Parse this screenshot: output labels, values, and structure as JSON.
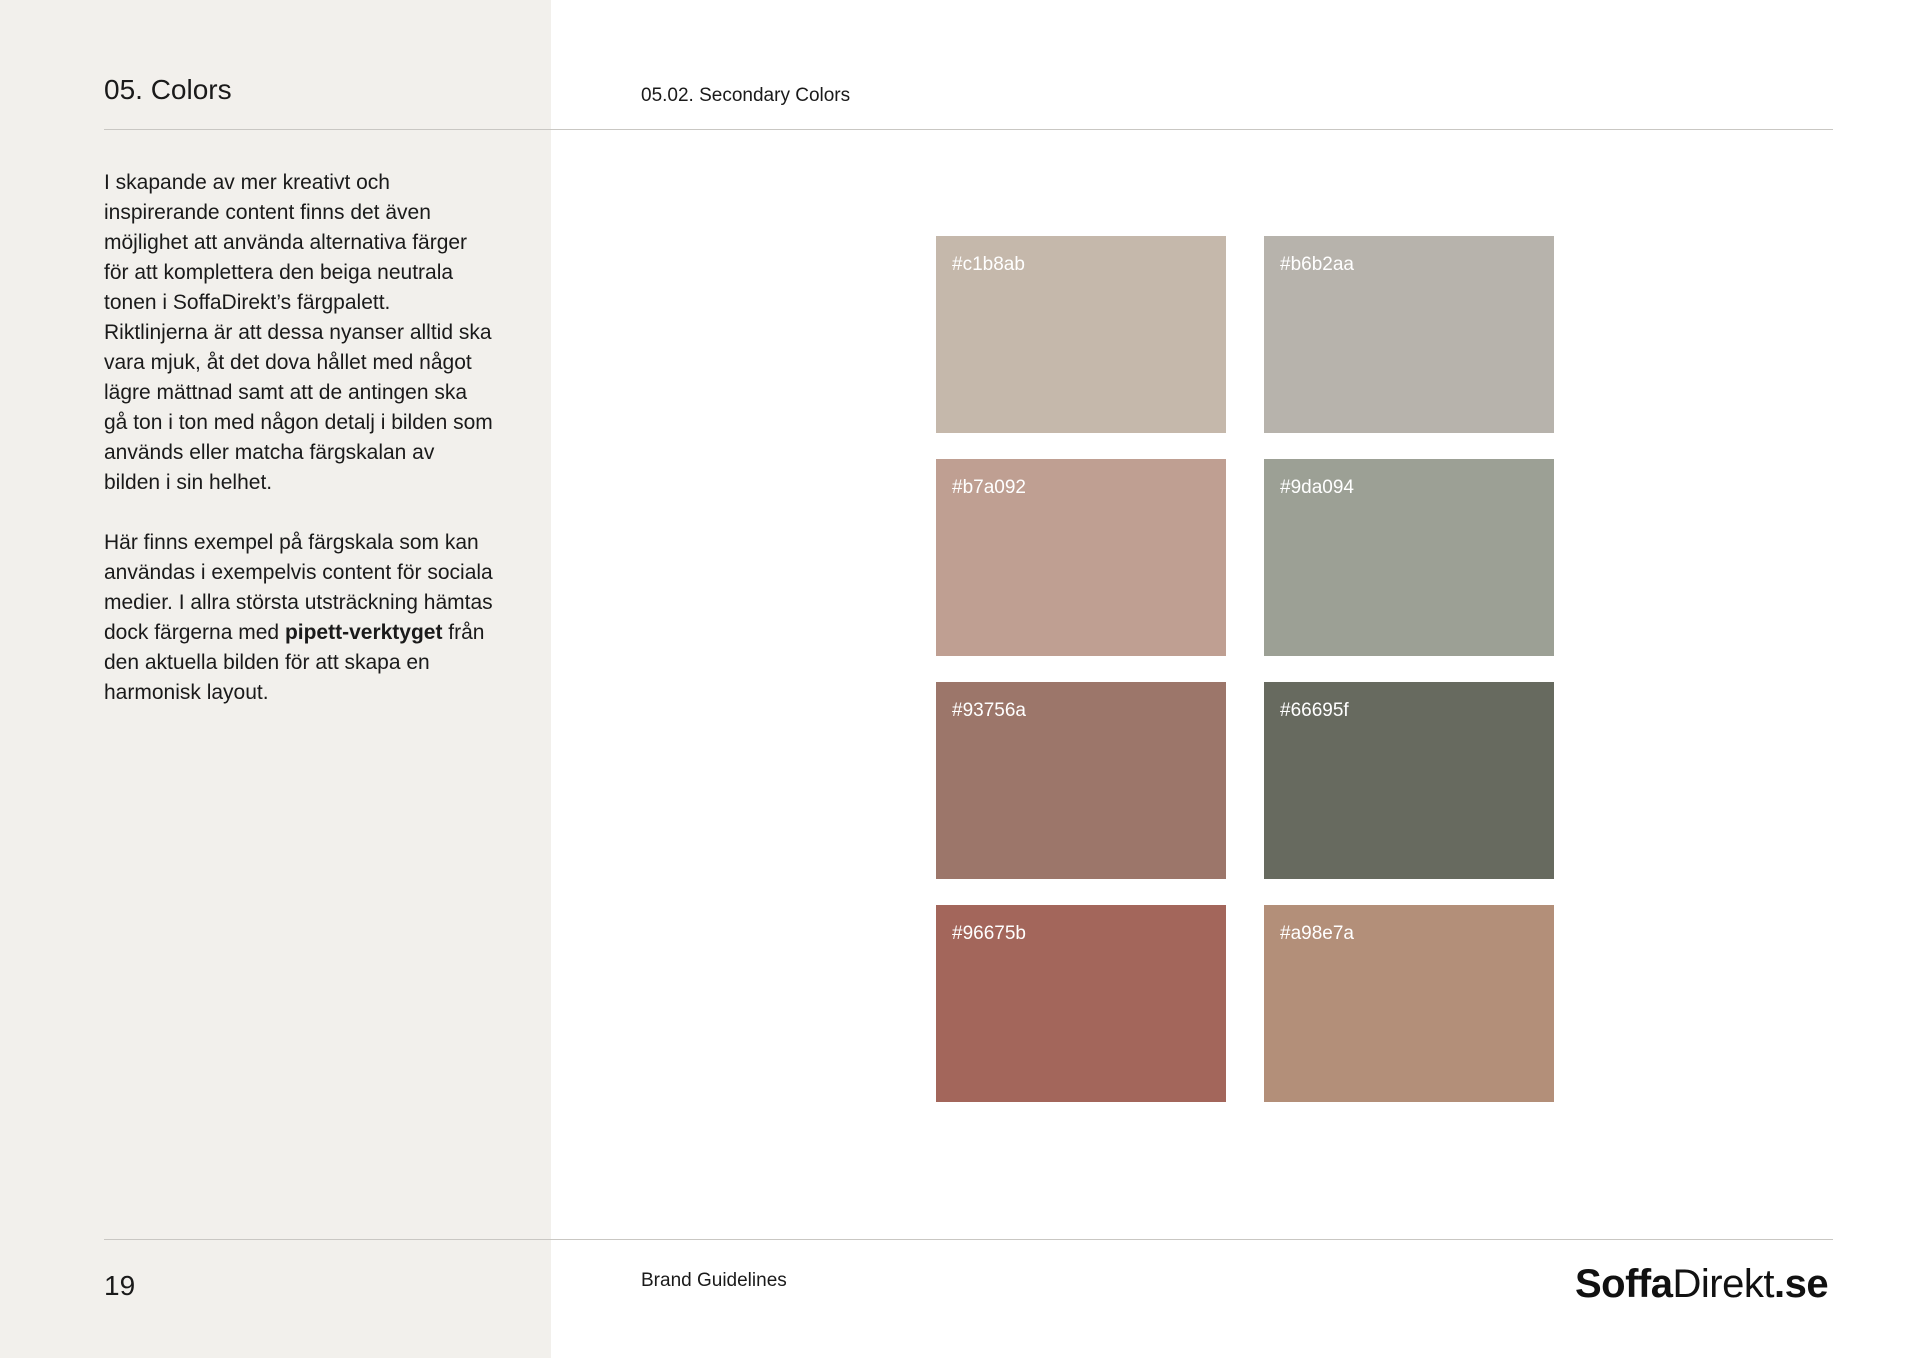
{
  "header": {
    "section_title": "05. Colors",
    "subsection_title": "05.02. Secondary Colors"
  },
  "body": {
    "paragraph1": "I skapande av mer kreativt och inspirerande content finns det även möjlighet att använda alternativa färger för att komplettera den beiga neutrala tonen i SoffaDirekt’s färgpalett. Riktlinjerna är att dessa nyanser alltid ska vara mjuk, åt det dova hållet med något lägre mättnad samt att de antingen ska gå ton i ton med någon detalj i bilden som används eller matcha färgskalan av bilden i sin helhet.",
    "paragraph2_before": "Här finns exempel på färgskala som kan användas i exempelvis content för sociala medier. I allra största utsträckning hämtas dock färgerna med ",
    "paragraph2_bold": "pipett-verktyget",
    "paragraph2_after": " från den aktuella bilden för att skapa en harmonisk layout."
  },
  "swatches": [
    {
      "label": "#c1b8ab",
      "color": "#c5b8ab"
    },
    {
      "label": "#b6b2aa",
      "color": "#b7b3ac"
    },
    {
      "label": "#b7a092",
      "color": "#bf9f92"
    },
    {
      "label": "#9da094",
      "color": "#9ca095"
    },
    {
      "label": "#93756a",
      "color": "#9c766a"
    },
    {
      "label": "#66695f",
      "color": "#676a5f"
    },
    {
      "label": "#96675b",
      "color": "#a3665b"
    },
    {
      "label": "#a98e7a",
      "color": "#b38f79"
    }
  ],
  "footer": {
    "page_number": "19",
    "label": "Brand Guidelines",
    "logo": {
      "part1": "Soffa",
      "part2": "Direkt",
      "part3": ".se"
    }
  }
}
